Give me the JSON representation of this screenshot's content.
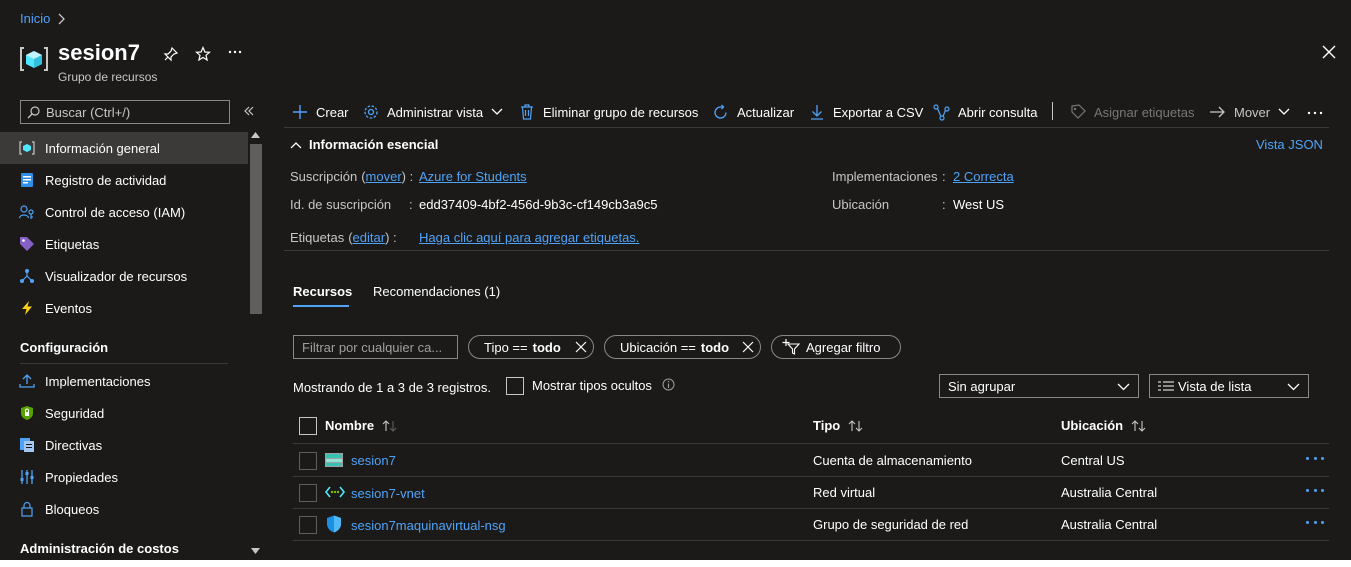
{
  "breadcrumb": {
    "home": "Inicio"
  },
  "header": {
    "title": "sesion7",
    "subtitle": "Grupo de recursos"
  },
  "search": {
    "placeholder": "Buscar (Ctrl+/)"
  },
  "sidebar": {
    "items": [
      {
        "label": "Información general",
        "icon": "resource-group-icon"
      },
      {
        "label": "Registro de actividad",
        "icon": "activity-log-icon"
      },
      {
        "label": "Control de acceso (IAM)",
        "icon": "iam-icon"
      },
      {
        "label": "Etiquetas",
        "icon": "tag-icon"
      },
      {
        "label": "Visualizador de recursos",
        "icon": "resource-visualizer-icon"
      },
      {
        "label": "Eventos",
        "icon": "lightning-icon"
      }
    ],
    "section_config": "Configuración",
    "config_items": [
      {
        "label": "Implementaciones",
        "icon": "deployments-icon"
      },
      {
        "label": "Seguridad",
        "icon": "shield-icon"
      },
      {
        "label": "Directivas",
        "icon": "policy-icon"
      },
      {
        "label": "Propiedades",
        "icon": "properties-icon"
      },
      {
        "label": "Bloqueos",
        "icon": "lock-icon"
      }
    ],
    "section_costs": "Administración de costos"
  },
  "toolbar": {
    "create": "Crear",
    "manage_view": "Administrar vista",
    "delete_group": "Eliminar grupo de recursos",
    "refresh": "Actualizar",
    "export_csv": "Exportar a CSV",
    "open_query": "Abrir consulta",
    "assign_tags": "Asignar etiquetas",
    "move": "Mover"
  },
  "essentials": {
    "title": "Información esencial",
    "json_view": "Vista JSON",
    "subscription_label": "Suscripción",
    "subscription_move": "mover",
    "subscription_value": "Azure for Students",
    "subscription_id_label": "Id. de suscripción",
    "subscription_id_value": "edd37409-4bf2-456d-9b3c-cf149cb3a9c5",
    "tags_label": "Etiquetas",
    "tags_edit": "editar",
    "tags_value": "Haga clic aquí para agregar etiquetas.",
    "deployments_label": "Implementaciones",
    "deployments_value": "2 Correcta",
    "location_label": "Ubicación",
    "location_value": "West US",
    "open_paren": "(",
    "close_paren_colon": ") :",
    "colon": ":"
  },
  "tabs": {
    "resources": "Recursos",
    "recommendations": "Recomendaciones (1)"
  },
  "filters": {
    "placeholder": "Filtrar por cualquier ca...",
    "type_label": "Tipo ==",
    "type_value": "todo",
    "location_label": "Ubicación ==",
    "location_value": "todo",
    "add_filter": "Agregar filtro"
  },
  "list": {
    "showing": "Mostrando de 1 a 3 de 3 registros.",
    "show_hidden": "Mostrar tipos ocultos",
    "grouping": "Sin agrupar",
    "view_mode": "Vista de lista",
    "columns": {
      "name": "Nombre",
      "type": "Tipo",
      "location": "Ubicación"
    },
    "rows": [
      {
        "name": "sesion7",
        "type": "Cuenta de almacenamiento",
        "location": "Central US",
        "icon": "storage-account-icon"
      },
      {
        "name": "sesion7-vnet",
        "type": "Red virtual",
        "location": "Australia Central",
        "icon": "virtual-network-icon"
      },
      {
        "name": "sesion7maquinavirtual-nsg",
        "type": "Grupo de seguridad de red",
        "location": "Australia Central",
        "icon": "nsg-shield-icon"
      }
    ]
  },
  "colors": {
    "background": "#1b1a19",
    "accent": "#4fa3f7",
    "selected_item": "#3b3a39"
  }
}
